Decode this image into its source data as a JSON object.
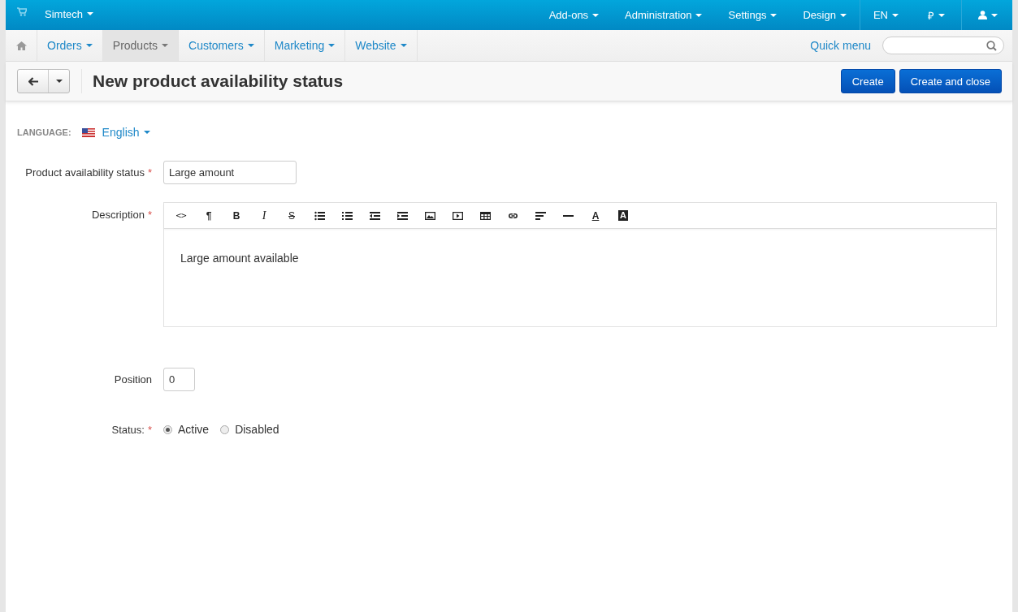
{
  "top_bar": {
    "store": "Simtech",
    "menus": [
      {
        "label": "Add-ons"
      },
      {
        "label": "Administration"
      },
      {
        "label": "Settings"
      },
      {
        "label": "Design"
      }
    ],
    "language": "EN",
    "currency": "₽"
  },
  "nav": {
    "items": [
      {
        "label": "Orders",
        "selected": false
      },
      {
        "label": "Products",
        "selected": true
      },
      {
        "label": "Customers",
        "selected": false
      },
      {
        "label": "Marketing",
        "selected": false
      },
      {
        "label": "Website",
        "selected": false
      }
    ],
    "quick_menu": "Quick menu"
  },
  "title_bar": {
    "title": "New product availability status",
    "buttons": [
      "Create",
      "Create and close"
    ]
  },
  "language": {
    "label": "LANGUAGE:",
    "value": "English"
  },
  "fields": [
    {
      "kind": "text",
      "label": "Product availability status",
      "required_mark": "*",
      "value": "Large amount"
    },
    {
      "kind": "editor",
      "label": "Description",
      "required_mark": "*",
      "toolbar": [
        {
          "kind": "code",
          "glyph": "<>"
        },
        {
          "kind": "paragraph",
          "glyph": "¶"
        },
        {
          "kind": "bold",
          "glyph": "B"
        },
        {
          "kind": "italic",
          "glyph": "I"
        },
        {
          "kind": "strike",
          "glyph": "S"
        },
        {
          "kind": "bullets"
        },
        {
          "kind": "numbers"
        },
        {
          "kind": "outdent"
        },
        {
          "kind": "indent"
        },
        {
          "kind": "image"
        },
        {
          "kind": "video"
        },
        {
          "kind": "table"
        },
        {
          "kind": "link"
        },
        {
          "kind": "align"
        },
        {
          "kind": "rule"
        },
        {
          "kind": "color",
          "glyph": "A"
        },
        {
          "kind": "background",
          "glyph": "A"
        }
      ],
      "value": "Large amount available"
    },
    {
      "kind": "number",
      "label": "Position",
      "value": "0"
    },
    {
      "kind": "radio",
      "label": "Status:",
      "required_mark": "*",
      "options": [
        {
          "label": "Active",
          "selected": true
        },
        {
          "label": "Disabled",
          "selected": false
        }
      ]
    }
  ]
}
